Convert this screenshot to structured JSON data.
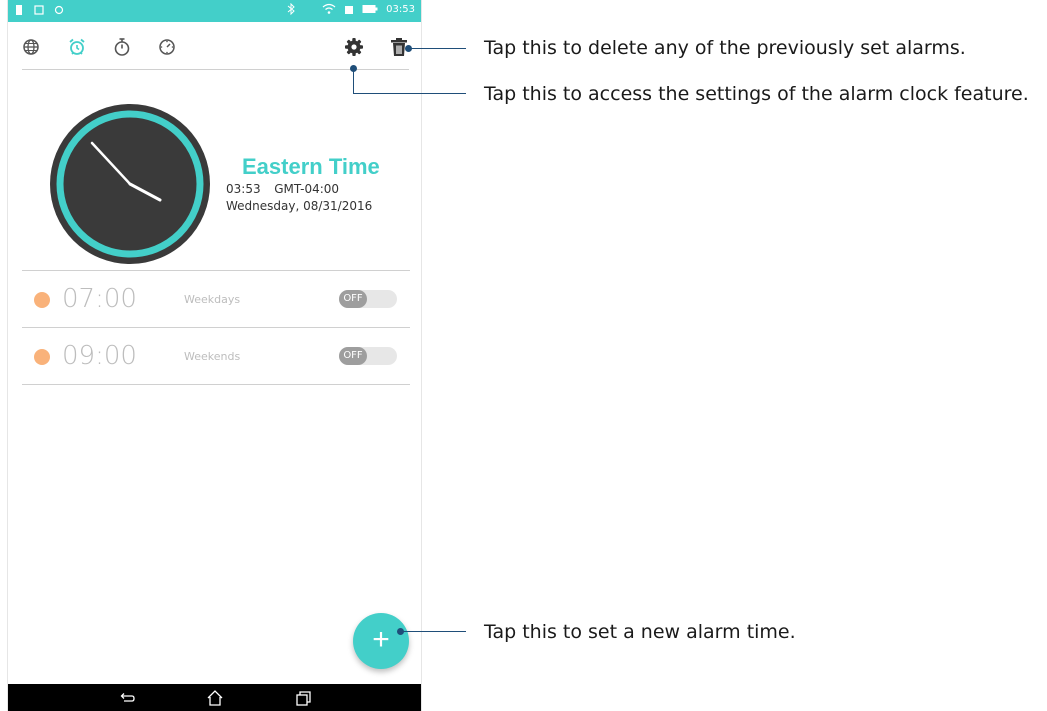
{
  "status_bar": {
    "time": "03:53"
  },
  "toolbar": {
    "icons": [
      "world-clock-icon",
      "alarm-icon",
      "stopwatch-icon",
      "timer-icon",
      "settings-icon",
      "delete-icon"
    ],
    "active_tab": "alarm",
    "accent_color": "#43cfc9"
  },
  "clock": {
    "timezone_name": "Eastern Time",
    "time": "03:53",
    "gmt_offset": "GMT-04:00",
    "date": "Wednesday, 08/31/2016"
  },
  "alarms": [
    {
      "time": "07:00",
      "days": "Weekdays",
      "toggle": "OFF"
    },
    {
      "time": "09:00",
      "days": "Weekends",
      "toggle": "OFF"
    }
  ],
  "fab": {
    "label": "+"
  },
  "callouts": {
    "delete": "Tap this to delete any of the previously set alarms.",
    "settings": "Tap this to access the settings of the alarm clock feature.",
    "add": "Tap this to set a new alarm time."
  }
}
